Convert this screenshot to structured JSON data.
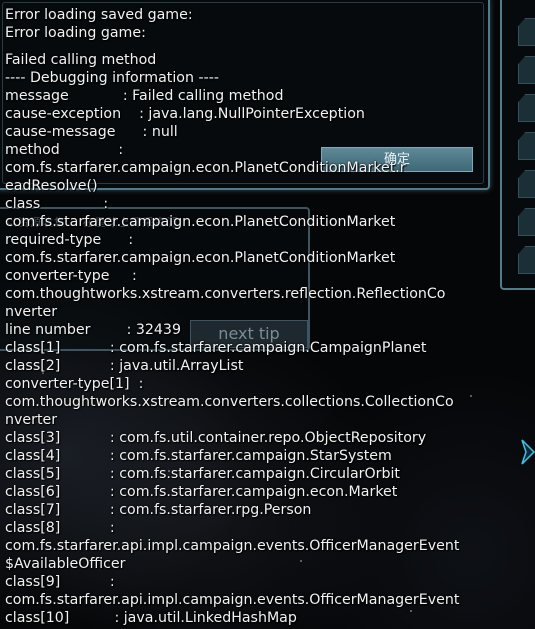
{
  "dialog": {
    "ok_label": "确定"
  },
  "tips": {
    "faded_text": "以资源收集… 在星球上开采资源",
    "next_tip_label": "next tip"
  },
  "error_log": {
    "lines": [
      "Error loading saved game:",
      "Error loading game:",
      "",
      "Failed calling method",
      "---- Debugging information ----",
      "message            : Failed calling method",
      "cause-exception    : java.lang.NullPointerException",
      "cause-message      : null",
      "method             :",
      "com.fs.starfarer.campaign.econ.PlanetConditionMarket.r",
      "eadResolve()",
      "class              :",
      "com.fs.starfarer.campaign.econ.PlanetConditionMarket",
      "required-type      :",
      "com.fs.starfarer.campaign.econ.PlanetConditionMarket",
      "converter-type     :",
      "com.thoughtworks.xstream.converters.reflection.ReflectionCo",
      "nverter",
      "line number        : 32439",
      "class[1]           : com.fs.starfarer.campaign.CampaignPlanet",
      "class[2]           : java.util.ArrayList",
      "converter-type[1]  :",
      "com.thoughtworks.xstream.converters.collections.CollectionCo",
      "nverter",
      "class[3]           : com.fs.util.container.repo.ObjectRepository",
      "class[4]           : com.fs.starfarer.campaign.StarSystem",
      "class[5]           : com.fs.starfarer.campaign.CircularOrbit",
      "class[6]           : com.fs.starfarer.campaign.econ.Market",
      "class[7]           : com.fs.starfarer.rpg.Person",
      "class[8]           :",
      "com.fs.starfarer.api.impl.campaign.events.OfficerManagerEvent",
      "$AvailableOfficer",
      "class[9]           :",
      "com.fs.starfarer.api.impl.campaign.events.OfficerManagerEvent",
      "class[10]          : java.util.LinkedHashMap"
    ]
  }
}
